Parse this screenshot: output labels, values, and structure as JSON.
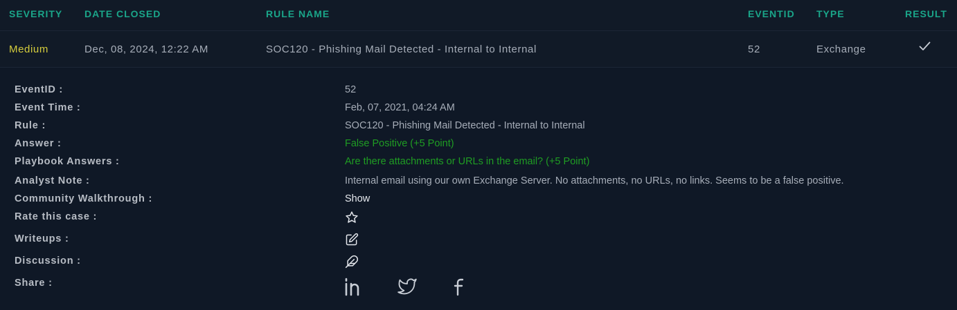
{
  "header": {
    "severity": "SEVERITY",
    "date_closed": "DATE CLOSED",
    "rule_name": "RULE NAME",
    "eventid": "EVENTID",
    "type": "TYPE",
    "result": "RESULT"
  },
  "row": {
    "severity": "Medium",
    "date_closed": "Dec, 08, 2024, 12:22 AM",
    "rule_name": "SOC120 - Phishing Mail Detected - Internal to Internal",
    "eventid": "52",
    "type": "Exchange",
    "result_icon": "check-icon"
  },
  "details": {
    "eventid_label": "EventID :",
    "eventid_value": "52",
    "event_time_label": "Event Time :",
    "event_time_value": "Feb, 07, 2021, 04:24 AM",
    "rule_label": "Rule :",
    "rule_value": "SOC120 - Phishing Mail Detected - Internal to Internal",
    "answer_label": "Answer :",
    "answer_value": "False Positive (+5 Point)",
    "playbook_label": "Playbook Answers :",
    "playbook_value": "Are there attachments or URLs in the email? (+5 Point)",
    "analyst_note_label": "Analyst Note :",
    "analyst_note_value": "Internal email using our own Exchange Server. No attachments, no URLs, no links. Seems to be a false positive.",
    "community_label": "Community Walkthrough :",
    "community_value": "Show",
    "rate_label": "Rate this case :",
    "writeups_label": "Writeups :",
    "discussion_label": "Discussion :",
    "share_label": "Share :"
  },
  "icons": {
    "rate": "star-icon",
    "writeups": "edit-icon",
    "discussion": "feather-icon",
    "share": [
      "linkedin-icon",
      "twitter-icon",
      "facebook-icon"
    ]
  },
  "colors": {
    "background": "#111a27",
    "header_text": "#1aa589",
    "severity_medium": "#d4cc3d",
    "answer_green": "#1f9d23"
  }
}
